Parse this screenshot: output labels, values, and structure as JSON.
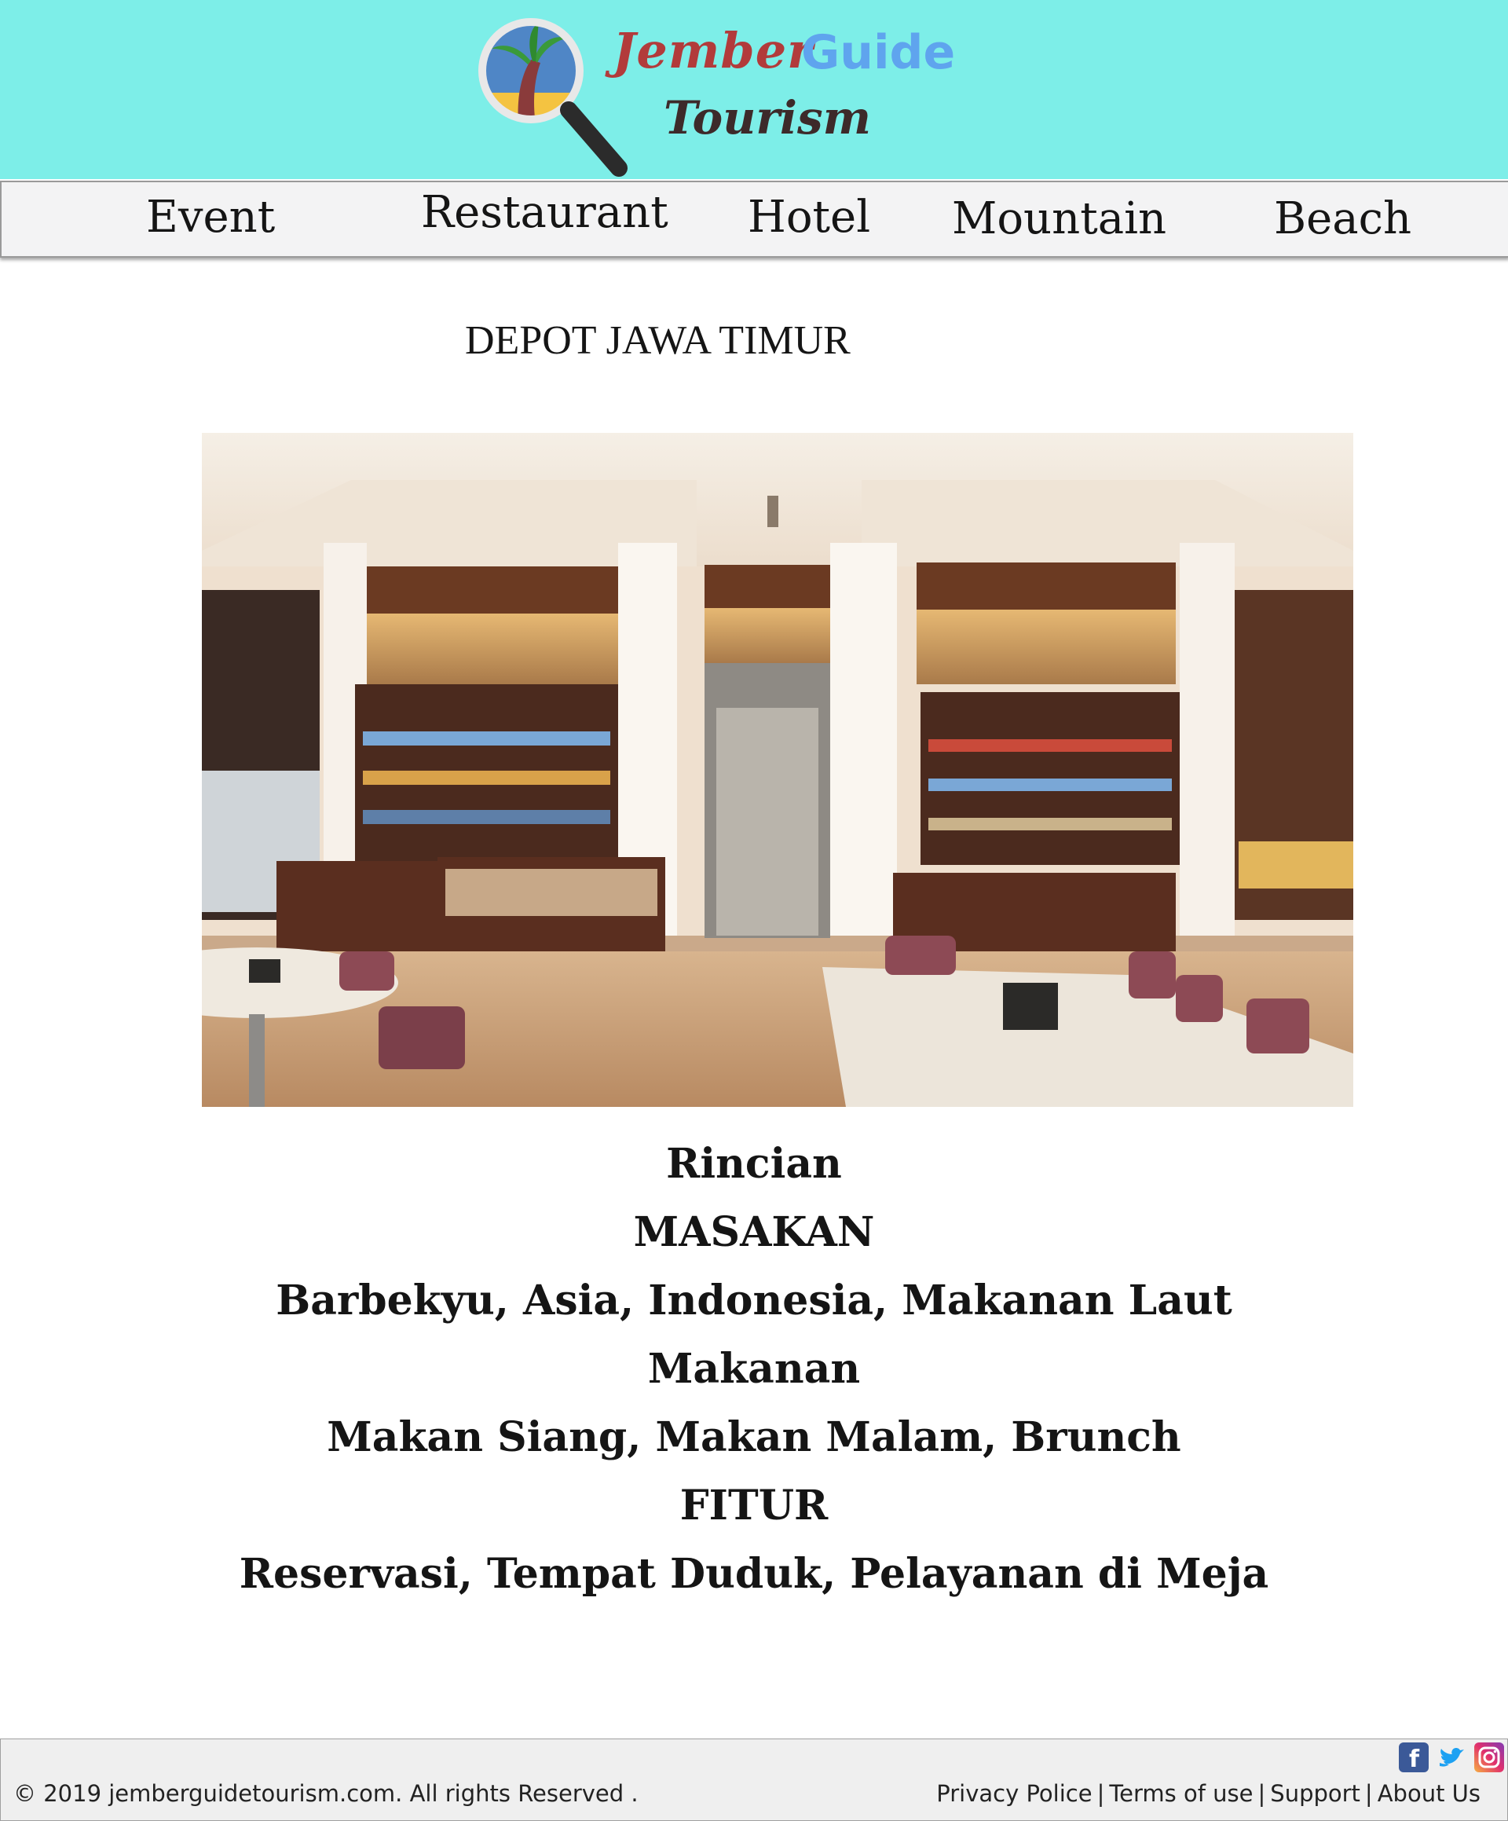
{
  "header": {
    "logo": {
      "word1": "Jember",
      "word2": "Guide",
      "word3": "Tourism"
    }
  },
  "nav": {
    "items": [
      {
        "label": "Event"
      },
      {
        "label": "Restaurant"
      },
      {
        "label": "Hotel"
      },
      {
        "label": "Mountain"
      },
      {
        "label": "Beach"
      }
    ]
  },
  "main": {
    "title": "DEPOT JAWA TIMUR",
    "details": [
      "Rincian",
      "MASAKAN",
      "Barbekyu, Asia, Indonesia, Makanan Laut",
      "Makanan",
      "Makan Siang, Makan Malam, Brunch",
      "FITUR",
      "Reservasi, Tempat Duduk, Pelayanan di Meja"
    ]
  },
  "footer": {
    "copyright": "© 2019 jemberguidetourism.com. All rights Reserved .",
    "links": [
      "Privacy Police",
      "Terms of use",
      "Support",
      "About Us"
    ],
    "separator": "|",
    "social": [
      {
        "icon": "facebook-icon",
        "color": "#3b5998"
      },
      {
        "icon": "twitter-icon",
        "color": "#1da1f2"
      },
      {
        "icon": "instagram-icon",
        "color": "#e1306c"
      }
    ]
  }
}
